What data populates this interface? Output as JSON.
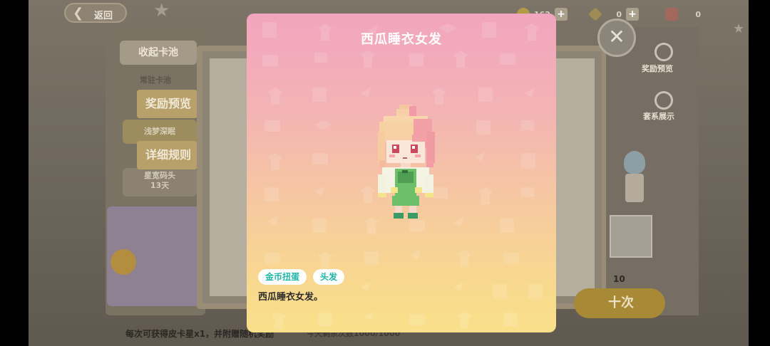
{
  "topbar": {
    "back_label": "返回",
    "coins": "162",
    "gems": "0",
    "tickets": "0"
  },
  "left_panel": {
    "collapse_label": "收起卡池",
    "regular_pool": "常驻卡池",
    "tab_reward": "奖励预览",
    "pool_dream": "浅梦深眠",
    "tab_rules": "详细规则",
    "pool_star_line1": "星宽码头",
    "pool_star_line2": "13天"
  },
  "right_panel": {
    "reward_preview": "奖励预览",
    "set_display": "套系展示",
    "count": "10",
    "draw_label": "十次"
  },
  "bottom": {
    "note": "每次可获得皮卡星x1，并附赠随机奖励",
    "note2": "今天剩余次数1000/1000"
  },
  "modal": {
    "title": "西瓜睡衣女发",
    "tags": [
      "金币扭蛋",
      "头发"
    ],
    "description": "西瓜睡衣女发。"
  }
}
